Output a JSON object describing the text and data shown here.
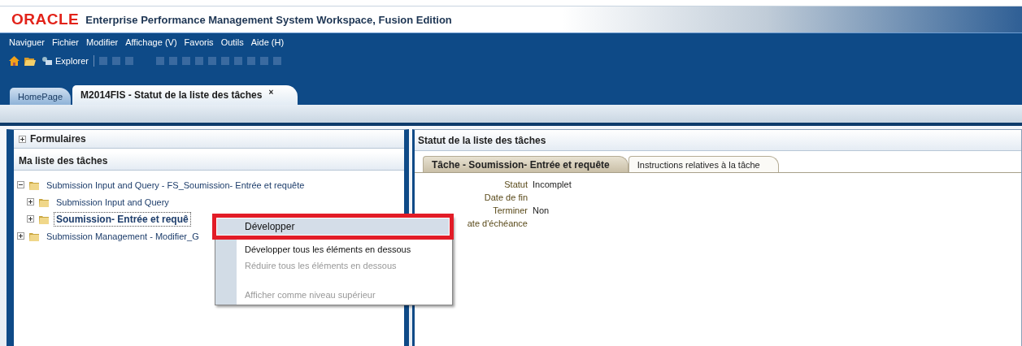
{
  "app": {
    "logo": "ORACLE",
    "title": "Enterprise Performance Management System Workspace, Fusion Edition"
  },
  "menu": [
    "Naviguer",
    "Fichier",
    "Modifier",
    "Affichage (V)",
    "Favoris",
    "Outils",
    "Aide (H)"
  ],
  "toolbar": {
    "explorer_label": "Explorer"
  },
  "tabs": [
    {
      "label": "HomePage",
      "selected": false,
      "closable": false
    },
    {
      "label": "M2014FIS - Statut de la liste des tâches",
      "selected": true,
      "closable": true,
      "close": "×"
    }
  ],
  "left_panel": {
    "sections": [
      {
        "label": "Formulaires",
        "expanded": false
      },
      {
        "label": "Ma liste des tâches",
        "expanded": true
      }
    ],
    "tree": [
      {
        "label": "Submission Input and Query - FS_Soumission- Entrée et requête",
        "expanded": true,
        "selected": false,
        "children": [
          {
            "label": "Submission Input and Query",
            "expanded": false,
            "selected": false
          },
          {
            "label": "Soumission- Entrée et requê",
            "expanded": false,
            "selected": true
          }
        ]
      },
      {
        "label": "Submission Management - Modifier_G",
        "expanded": false,
        "selected": false
      }
    ]
  },
  "right_panel": {
    "title": "Statut de la liste des tâches",
    "tabs": [
      {
        "label": "Tâche - Soumission- Entrée et requête",
        "selected": true
      },
      {
        "label": "Instructions relatives à la tâche",
        "selected": false
      }
    ],
    "fields": [
      {
        "label": "Statut",
        "value": "Incomplet"
      },
      {
        "label": "Date de fin"
      },
      {
        "label": "Terminer",
        "value": "Non"
      },
      {
        "label": "ate d'échéance"
      }
    ]
  },
  "context_menu": {
    "items": [
      {
        "kind": "item",
        "label": "Développer",
        "disabled": false,
        "highlighted": true
      },
      {
        "kind": "item",
        "label": "Développer tous les éléments en dessous",
        "disabled": false,
        "highlighted": false
      },
      {
        "kind": "item",
        "label": "Réduire tous les éléments en dessous",
        "disabled": true,
        "highlighted": false
      },
      {
        "kind": "gap"
      },
      {
        "kind": "item",
        "label": "Afficher comme niveau supérieur",
        "disabled": true,
        "highlighted": false
      }
    ]
  }
}
